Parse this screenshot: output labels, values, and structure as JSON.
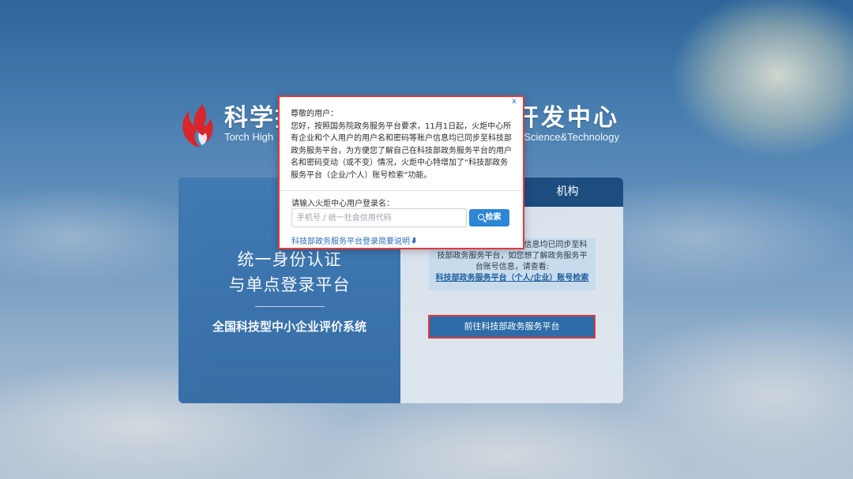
{
  "header": {
    "brand_cn_left": "科学技",
    "brand_en_left": "Torch High",
    "brand_cn_right": "开发中心",
    "brand_en_right": "Science&Technology"
  },
  "card": {
    "tab_org": "机构",
    "title_line1": "统一身份认证",
    "title_line2": "与单点登录平台",
    "subtitle": "全国科技型中小企业评价系统",
    "notice_text": "户的用户名和密码等账户信息均已同步至科技部政务服务平台，如您想了解政务服务平台账号信息，请查看:",
    "notice_link": "科技部政务服务平台（个人/企业）账号检索",
    "go_button": "前往科技部政务服务平台"
  },
  "modal": {
    "close": "x",
    "greeting": "尊敬的用户：",
    "message": "您好，按照国务院政务服务平台要求，11月1日起，火炬中心所有企业和个人用户的用户名和密码等账户信息均已同步至科技部政务服务平台，为方便您了解自己在科技部政务服务平台的用户名和密码变动（或不变）情况，火炬中心特增加了“科技部政务服务平台（企业/个人）账号检索”功能。",
    "input_label": "请输入火炬中心用户登录名：",
    "input_placeholder": "手机号 / 统一社会信用代码",
    "input_value": "",
    "search_button": "检索",
    "guide_link": "科技部政务服务平台登录简要说明"
  },
  "colors": {
    "accent": "#2d86d6",
    "highlight_border": "#e33a3a",
    "tab_bar": "#1d4c7f",
    "card_left": "#3570ac"
  },
  "icons": [
    "torch-logo-icon",
    "search-icon",
    "download-icon",
    "close-icon"
  ]
}
